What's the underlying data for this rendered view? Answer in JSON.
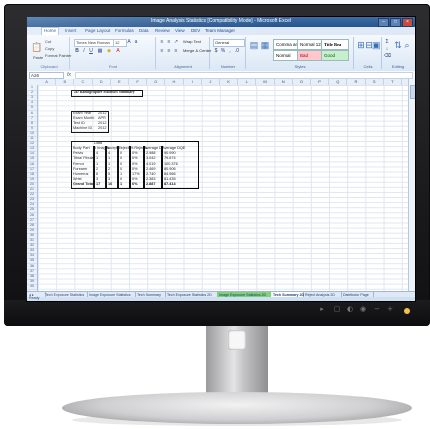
{
  "window": {
    "title": "Image Analysis Statistics [Compatibility Mode] - Microsoft Excel"
  },
  "ribbon_tabs": [
    "Home",
    "Insert",
    "Page Layout",
    "Formulas",
    "Data",
    "Review",
    "View",
    "DEV",
    "Team Manager"
  ],
  "ribbon": {
    "clipboard": {
      "cut": "Cut",
      "copy": "Copy",
      "paste": "Paste",
      "format_painter": "Format Painter",
      "label": "Clipboard"
    },
    "font": {
      "name": "Times New Roman",
      "size": "12",
      "label": "Font"
    },
    "alignment": {
      "wrap": "Wrap Text",
      "merge": "Merge & Center",
      "label": "Alignment"
    },
    "number": {
      "format": "General",
      "label": "Number"
    },
    "styles": {
      "conditional": "Conditional Formatting",
      "format_table": "Format as Table",
      "normal_2": "Comma and Be...",
      "normal_3": "Normal 12",
      "title_style": "Title Bea",
      "normal": "Normal",
      "bad": "Bad",
      "good": "Good",
      "label": "Styles"
    },
    "cells": {
      "insert": "Insert",
      "delete": "Delete",
      "format": "Format",
      "label": "Cells"
    },
    "editing": {
      "autosum": "AutoSum",
      "fill": "Fill",
      "clear": "Clear",
      "sort": "Sort & Filter",
      "find": "Find & Select",
      "label": "Editing"
    }
  },
  "formula_bar": {
    "name_box": "A26",
    "fx": "fx",
    "value": ""
  },
  "columns": [
    "A",
    "B",
    "C",
    "D",
    "E",
    "F",
    "G",
    "H",
    "I",
    "J",
    "K",
    "L",
    "M",
    "N",
    "O",
    "P",
    "Q",
    "R",
    "S",
    "T"
  ],
  "sheet": {
    "title": "2D Radiographer Statistics Summary",
    "info_rows": [
      {
        "label": "Exam Year",
        "value": "2012"
      },
      {
        "label": "Exam Month",
        "value": "APR"
      },
      {
        "label": "Test ID",
        "value": "2012"
      },
      {
        "label": "Machine ID",
        "value": "2012"
      }
    ],
    "table_header_top": "Data",
    "table_headers": [
      "Body Part",
      "# Images",
      "Accepts",
      "Rejects",
      "% Rejects",
      "Average DI",
      "Average DQE"
    ],
    "table_rows": [
      [
        "Pelvis",
        "4",
        "4",
        "0",
        "0%",
        "2.988",
        "90.990"
      ],
      [
        "Tibia/ Fibula",
        "1",
        "1",
        "0",
        "0%",
        "3.042",
        "79.674"
      ],
      [
        "Femur",
        "1",
        "1",
        "0",
        "0%",
        "4.019",
        "100.376"
      ],
      [
        "Forearm",
        "2",
        "2",
        "0",
        "0%",
        "2.469",
        "80.906"
      ],
      [
        "Humerus",
        "6",
        "5",
        "1",
        "17%",
        "2.740",
        "84.966"
      ],
      [
        "Wrist",
        "3",
        "3",
        "0",
        "0%",
        "2.383",
        "81.435"
      ],
      [
        "Grand Total",
        "17",
        "16",
        "1",
        "6%",
        "2.887",
        "87.414"
      ]
    ]
  },
  "sheet_tabs": [
    "Tech Exposure Statistics",
    "Image Exposure Statistics",
    "Tech Summary",
    "Tech Exposure Statistics 2D",
    "Image Exposure Statistics 2D",
    "Tech Summary 2D",
    "Reject Analysis 2D",
    "Distributor Page"
  ],
  "active_sheet_index": 5,
  "highlighted_sheet_index": 4,
  "status_text": "Ready",
  "colors": {
    "titlebar": "#25538c",
    "ribbon": "#dbe7f5",
    "active_tab_highlight": "#7fd17a",
    "power_led": "#f2c14a",
    "bad_style": "#ffc7ce",
    "good_style": "#c6efce"
  }
}
